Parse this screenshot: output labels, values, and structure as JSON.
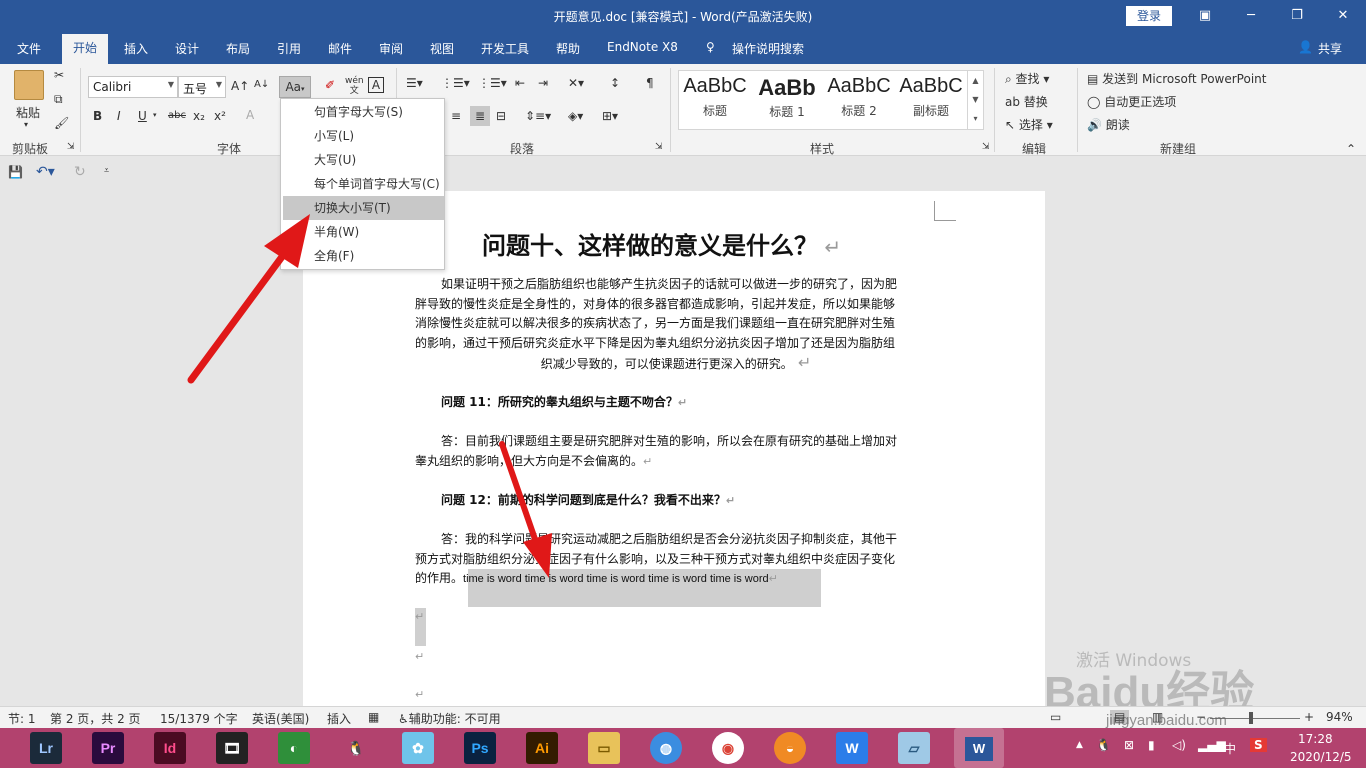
{
  "window": {
    "title": "开题意见.doc [兼容模式]  -  Word(产品激活失败)",
    "login": "登录"
  },
  "tabs": [
    "文件",
    "开始",
    "插入",
    "设计",
    "布局",
    "引用",
    "邮件",
    "审阅",
    "视图",
    "开发工具",
    "帮助",
    "EndNote X8",
    "操作说明搜索",
    "共享"
  ],
  "ribbon": {
    "clipboard": {
      "paste": "粘贴",
      "label": "剪贴板"
    },
    "font": {
      "name": "Calibri",
      "size": "五号",
      "label": "字体",
      "aa": "Aa",
      "wen": "wén"
    },
    "paragraph": {
      "label": "段落"
    },
    "styles": {
      "label": "样式",
      "items": [
        {
          "preview": "AaBbC",
          "name": "标题"
        },
        {
          "preview": "AaBb",
          "name": "标题 1"
        },
        {
          "preview": "AaBbC",
          "name": "标题 2"
        },
        {
          "preview": "AaBbC",
          "name": "副标题"
        }
      ]
    },
    "editing": {
      "label": "编辑",
      "find": "查找",
      "replace": "替换",
      "select": "选择"
    },
    "newgroup": {
      "label": "新建组",
      "ppt": "发送到 Microsoft PowerPoint",
      "autocorrect": "自动更正选项",
      "read": "朗读"
    }
  },
  "case_menu": {
    "items": [
      "句首字母大写(S)",
      "小写(L)",
      "大写(U)",
      "每个单词首字母大写(C)",
      "切换大小写(T)",
      "半角(W)",
      "全角(F)"
    ],
    "highlighted": 4
  },
  "document": {
    "heading": "问题十、这样做的意义是什么？",
    "p1": [
      "如果证明干预之后脂肪组织也能够产生抗炎因子的话就可以做进一步的研究了，因为肥",
      "胖导致的慢性炎症是全身性的，对身体的很多器官都造成影响，引起并发症，所以如果能够",
      "消除慢性炎症就可以解决很多的疾病状态了，另一方面是我们课题组一直在研究肥胖对生殖",
      "的影响，通过干预后研究炎症水平下降是因为睾丸组织分泌抗炎因子增加了还是因为脂肪组",
      "织减少导致的，可以使课题进行更深入的研究。"
    ],
    "q11": "问题 11：所研究的睾丸组织与主题不吻合？",
    "a11": [
      "答：目前我们课题组主要是研究肥胖对生殖的影响，所以会在原有研究的基础上增加对",
      "睾丸组织的影响，但大方向是不会偏离的。"
    ],
    "q12": "问题 12：前期的科学问题到底是什么？我看不出来？",
    "a12": [
      "答：我的科学问题是研究运动减肥之后脂肪组织是否会分泌抗炎因子抑制炎症，其他干",
      "预方式对脂肪组织分泌炎症因子有什么影响，以及三种干预方式对睾丸组织中炎症因子变化",
      "的作用。"
    ],
    "english": "time is word time is word time is word time is word time is word"
  },
  "status": {
    "section": "节: 1",
    "page": "第 2 页，共 2 页",
    "words": "15/1379 个字",
    "lang": "英语(美国)",
    "mode": "插入",
    "access": "辅助功能: 不可用",
    "zoom": "94%"
  },
  "taskbar": {
    "apps": [
      "Lr",
      "Pr",
      "Id",
      "Ps",
      "Ai"
    ],
    "time": "17:28",
    "date": "2020/12/5",
    "ime": "中"
  },
  "watermark": {
    "activate": "激活 Windows",
    "brand": "Baidu经验",
    "url": "jingyan.baidu.com"
  }
}
